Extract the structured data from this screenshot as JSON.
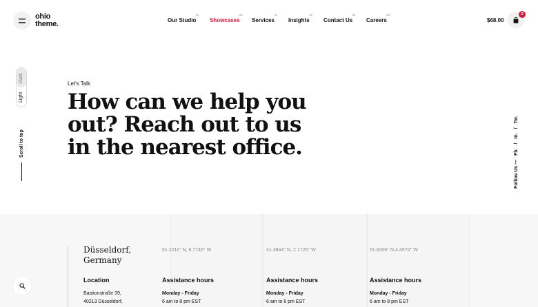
{
  "brand": {
    "line1": "ohio",
    "line2": "theme."
  },
  "nav": [
    {
      "label": "Our Studio",
      "num": "01"
    },
    {
      "label": "Showcases",
      "num": "02",
      "active": true
    },
    {
      "label": "Services",
      "num": "03"
    },
    {
      "label": "Insights",
      "num": "04"
    },
    {
      "label": "Contact Us",
      "num": "05"
    },
    {
      "label": "Careers",
      "num": "06"
    }
  ],
  "cart": {
    "total": "$68.00",
    "count": "0"
  },
  "theme_toggle": {
    "dark": "Dark",
    "light": "Light"
  },
  "scroll_top": "Scroll to top",
  "follow": {
    "label": "Follow Us —",
    "links": [
      "Fb.",
      "/",
      "In.",
      "/",
      "Tw."
    ]
  },
  "hero": {
    "eyebrow": "Let's Talk",
    "headline": "How can we help you out? Reach out to us in the nearest office."
  },
  "office": {
    "city_line1": "Düsseldorf,",
    "city_line2": "Germany",
    "location_label": "Location",
    "address_line1": "Bastionstraße 39,",
    "address_line2": "40213 Düsseldorf,"
  },
  "columns": [
    {
      "coord": "51.2211° N, 6.7745° W",
      "hours_label": "Assistance hours",
      "days": "Monday - Friday",
      "time": "6 am to 8 pm EST"
    },
    {
      "coord": "41.3944° N, 2.1725° W",
      "hours_label": "Assistance hours",
      "days": "Monday - Friday",
      "time": "6 am to 8 pm EST"
    },
    {
      "coord": "51.9206° N,4.4570° W",
      "hours_label": "Assistance hours",
      "days": "Monday - Friday",
      "time": "6 am to 8 pm EST"
    }
  ],
  "colors": {
    "accent": "#d4193a",
    "text": "#111111",
    "strip_bg": "#f7f7f7"
  }
}
